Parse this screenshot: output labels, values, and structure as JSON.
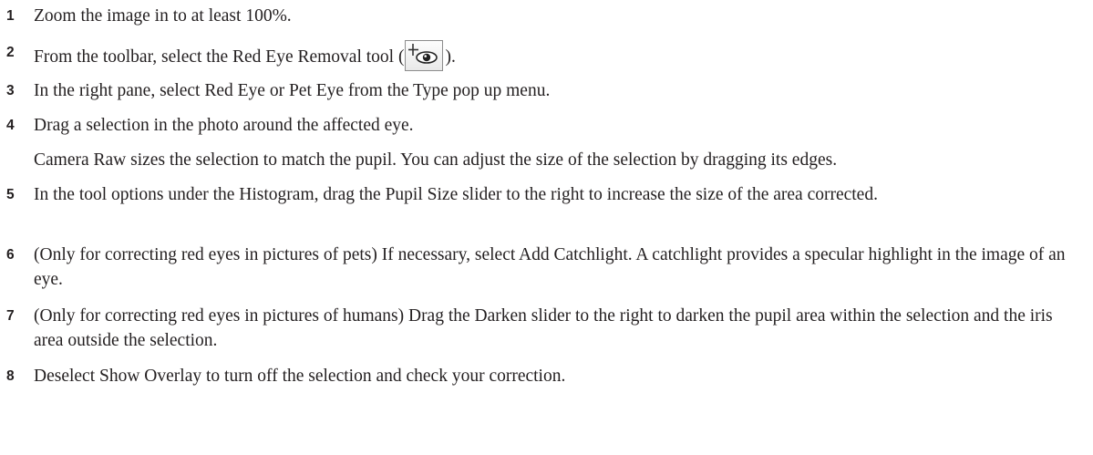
{
  "steps": [
    {
      "number": "1",
      "text": "Zoom the image in to at least 100%."
    },
    {
      "number": "2",
      "text_before": "From the toolbar, select the Red Eye Removal tool (",
      "icon": "red-eye-removal-icon",
      "text_after": ")."
    },
    {
      "number": "3",
      "text": "In the right pane, select Red Eye or Pet Eye from the Type pop up menu."
    },
    {
      "number": "4",
      "text": "Drag a selection in the photo around the affected eye."
    },
    {
      "number": "",
      "text": "Camera Raw sizes the selection to match the pupil. You can adjust the size of the selection by dragging its edges."
    },
    {
      "number": "5",
      "text": "In the tool options under the Histogram, drag the Pupil Size slider to the right to increase the size of the area corrected."
    },
    {
      "number": "6",
      "text": "(Only for correcting red eyes in pictures of pets) If necessary, select Add Catchlight. A catchlight provides a specular highlight in the image of an eye."
    },
    {
      "number": "7",
      "text": "(Only for correcting red eyes in pictures of humans) Drag the Darken slider to the right to darken the pupil area within the selection and the iris area outside the selection."
    },
    {
      "number": "8",
      "text": "Deselect Show Overlay to turn off the selection and check your correction."
    }
  ]
}
